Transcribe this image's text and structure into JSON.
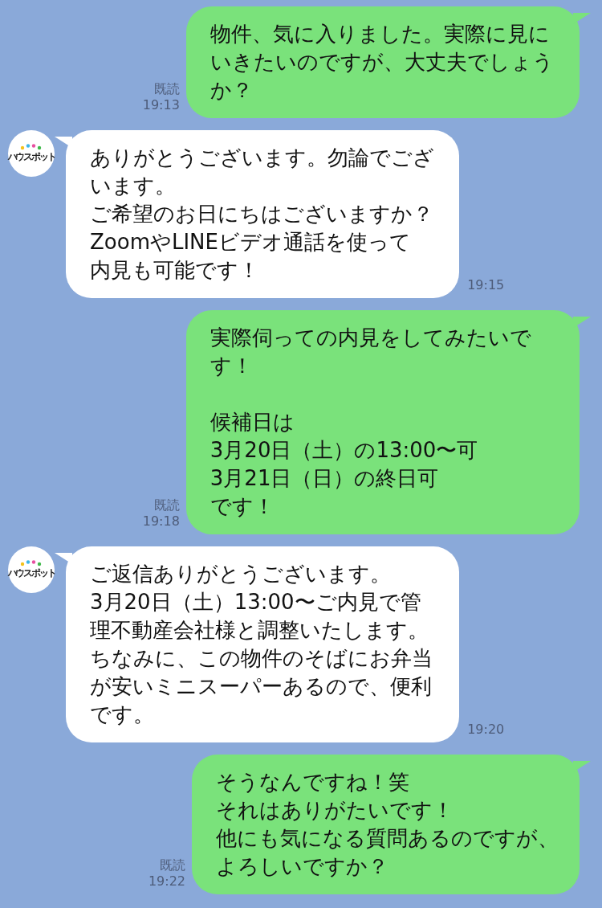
{
  "messages": [
    {
      "kind": "sent",
      "paragraphs": [
        [
          "物件、気に入りました。実際に見にいきたいのですが、大丈夫でしょうか？"
        ]
      ],
      "read": "既読",
      "time": "19:13"
    },
    {
      "kind": "received",
      "avatar": "ハウスポット",
      "paragraphs": [
        [
          "ありがとうございます。勿論でございます。",
          "ご希望のお日にちはございますか？",
          "ZoomやLINEビデオ通話を使って",
          "内見も可能です！"
        ]
      ],
      "time": "19:15"
    },
    {
      "kind": "sent",
      "paragraphs": [
        [
          "実際伺っての内見をしてみたいです！"
        ],
        [
          "候補日は",
          "3月20日（土）の13:00〜可",
          "3月21日（日）の終日可",
          "です！"
        ]
      ],
      "read": "既読",
      "time": "19:18"
    },
    {
      "kind": "received",
      "avatar": "ハウスポット",
      "paragraphs": [
        [
          "ご返信ありがとうございます。",
          "3月20日（土）13:00〜ご内見で管理不動産会社様と調整いたします。",
          "ちなみに、この物件のそばにお弁当が安いミニスーパーあるので、便利です。"
        ]
      ],
      "time": "19:20"
    },
    {
      "kind": "sent",
      "paragraphs": [
        [
          "そうなんですね！笑",
          "それはありがたいです！",
          "他にも気になる質問あるのですが、",
          "よろしいですか？"
        ]
      ],
      "read": "既読",
      "time": "19:22"
    }
  ]
}
